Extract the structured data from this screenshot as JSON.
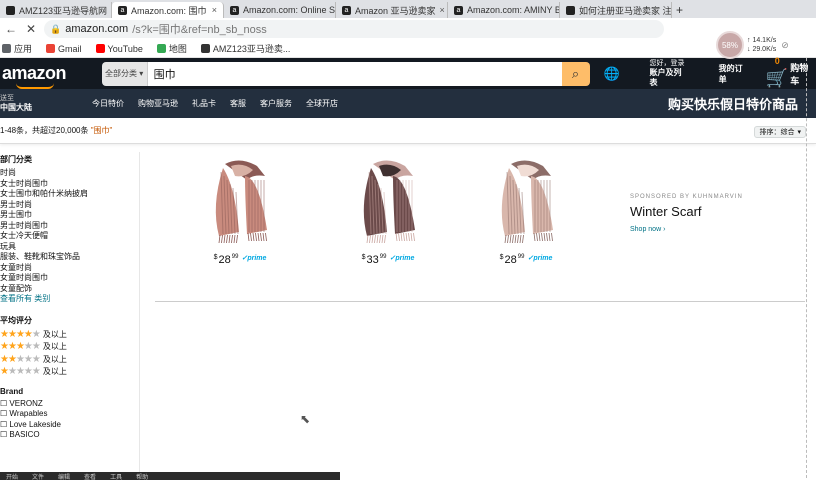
{
  "browser": {
    "tabs": [
      {
        "label": "AMZ123亚马逊导航网",
        "active": false
      },
      {
        "label": "Amazon.com: 围巾",
        "active": true
      },
      {
        "label": "Amazon.com: Online Sh",
        "active": false
      },
      {
        "label": "Amazon 亚马逊卖家",
        "active": false
      },
      {
        "label": "Amazon.com: AMINY B",
        "active": false
      },
      {
        "label": "如何注册亚马逊卖家 注册",
        "active": false
      }
    ],
    "new_tab": "+",
    "back": "←",
    "reload": "✕",
    "address": {
      "host": "amazon.com",
      "path": "/s?k=围巾&ref=nb_sb_noss"
    },
    "bookmarks": [
      {
        "label": "应用",
        "icon": "apps-icon",
        "color": "#5f6368"
      },
      {
        "label": "Gmail",
        "icon": "gmail-icon",
        "color": "#ea4335"
      },
      {
        "label": "YouTube",
        "icon": "youtube-icon",
        "color": "#ff0000"
      },
      {
        "label": "地图",
        "icon": "maps-icon",
        "color": "#34a853"
      },
      {
        "label": "AMZ123亚马逊卖...",
        "icon": "amz123-icon",
        "color": "#333333"
      }
    ],
    "perf_widget": {
      "percent": "58%",
      "up": "14.1K/s",
      "down": "29.0K/s"
    }
  },
  "amazon": {
    "logo": "amazon",
    "search": {
      "department": "全部分类",
      "query": "围巾",
      "button_icon": "search-icon"
    },
    "globe_icon": "globe-icon",
    "account": {
      "line1": "您好，登录",
      "line2": "账户及列表"
    },
    "orders": "我的订单",
    "cart": {
      "count": "0",
      "label": "购物车"
    },
    "deliver": {
      "line1": "送至",
      "line2": "中国大陆"
    },
    "nav_links": [
      "今日特价",
      "购物亚马逊",
      "礼品卡",
      "客服",
      "客户服务",
      "全球开店"
    ],
    "promo": "购买快乐假日特价商品"
  },
  "results": {
    "summary": "1-48条，共超过20,000条",
    "query_quoted": "\"围巾\"",
    "sort_label": "排序：综合"
  },
  "sidebar": {
    "dept_heading": "部门分类",
    "dept_items": [
      {
        "label": "时尚",
        "sub": false
      },
      {
        "label": "女士时尚围巾",
        "sub": false
      },
      {
        "label": "女士围巾和帕什米纳披肩",
        "sub": false
      },
      {
        "label": "男士时尚",
        "sub": false
      },
      {
        "label": "男士围巾",
        "sub": false
      },
      {
        "label": "男士时尚围巾",
        "sub": false
      },
      {
        "label": "女士冷天便帽",
        "sub": false
      },
      {
        "label": "玩具",
        "sub": false
      },
      {
        "label": "服装、鞋靴和珠宝饰品",
        "sub": false
      },
      {
        "label": "女童时尚",
        "sub": false
      },
      {
        "label": "女童时尚围巾",
        "sub": false
      },
      {
        "label": "女童配饰",
        "sub": false
      },
      {
        "label": "查看所有 类别",
        "sub": true
      }
    ],
    "review_heading": "平均评分",
    "reviews": [
      {
        "stars": 4,
        "label": "及以上"
      },
      {
        "stars": 3,
        "label": "及以上"
      },
      {
        "stars": 2,
        "label": "及以上"
      },
      {
        "stars": 1,
        "label": "及以上"
      }
    ],
    "brand_heading": "Brand",
    "brands": [
      "VERONZ",
      "Wrapables",
      "Love Lakeside",
      "BASICO"
    ]
  },
  "products": [
    {
      "dollars": "28",
      "cents": "99",
      "currency": "$",
      "prime": "prime",
      "colors": [
        "#c98b7e",
        "#8b5a55",
        "#d8b1a5"
      ]
    },
    {
      "dollars": "33",
      "cents": "99",
      "currency": "$",
      "prime": "prime",
      "colors": [
        "#6b4a4a",
        "#c9a5a0",
        "#3f3030"
      ]
    },
    {
      "dollars": "28",
      "cents": "99",
      "currency": "$",
      "prime": "prime",
      "colors": [
        "#d9b7ac",
        "#8c6d68",
        "#f0dcd4"
      ]
    }
  ],
  "sponsored": {
    "label": "SPONSORED BY KUHNMARVIN",
    "title": "Winter Scarf",
    "link": "Shop now ›"
  },
  "taskbar": [
    "开始",
    "文件",
    "编辑",
    "查看",
    "工具",
    "帮助"
  ]
}
